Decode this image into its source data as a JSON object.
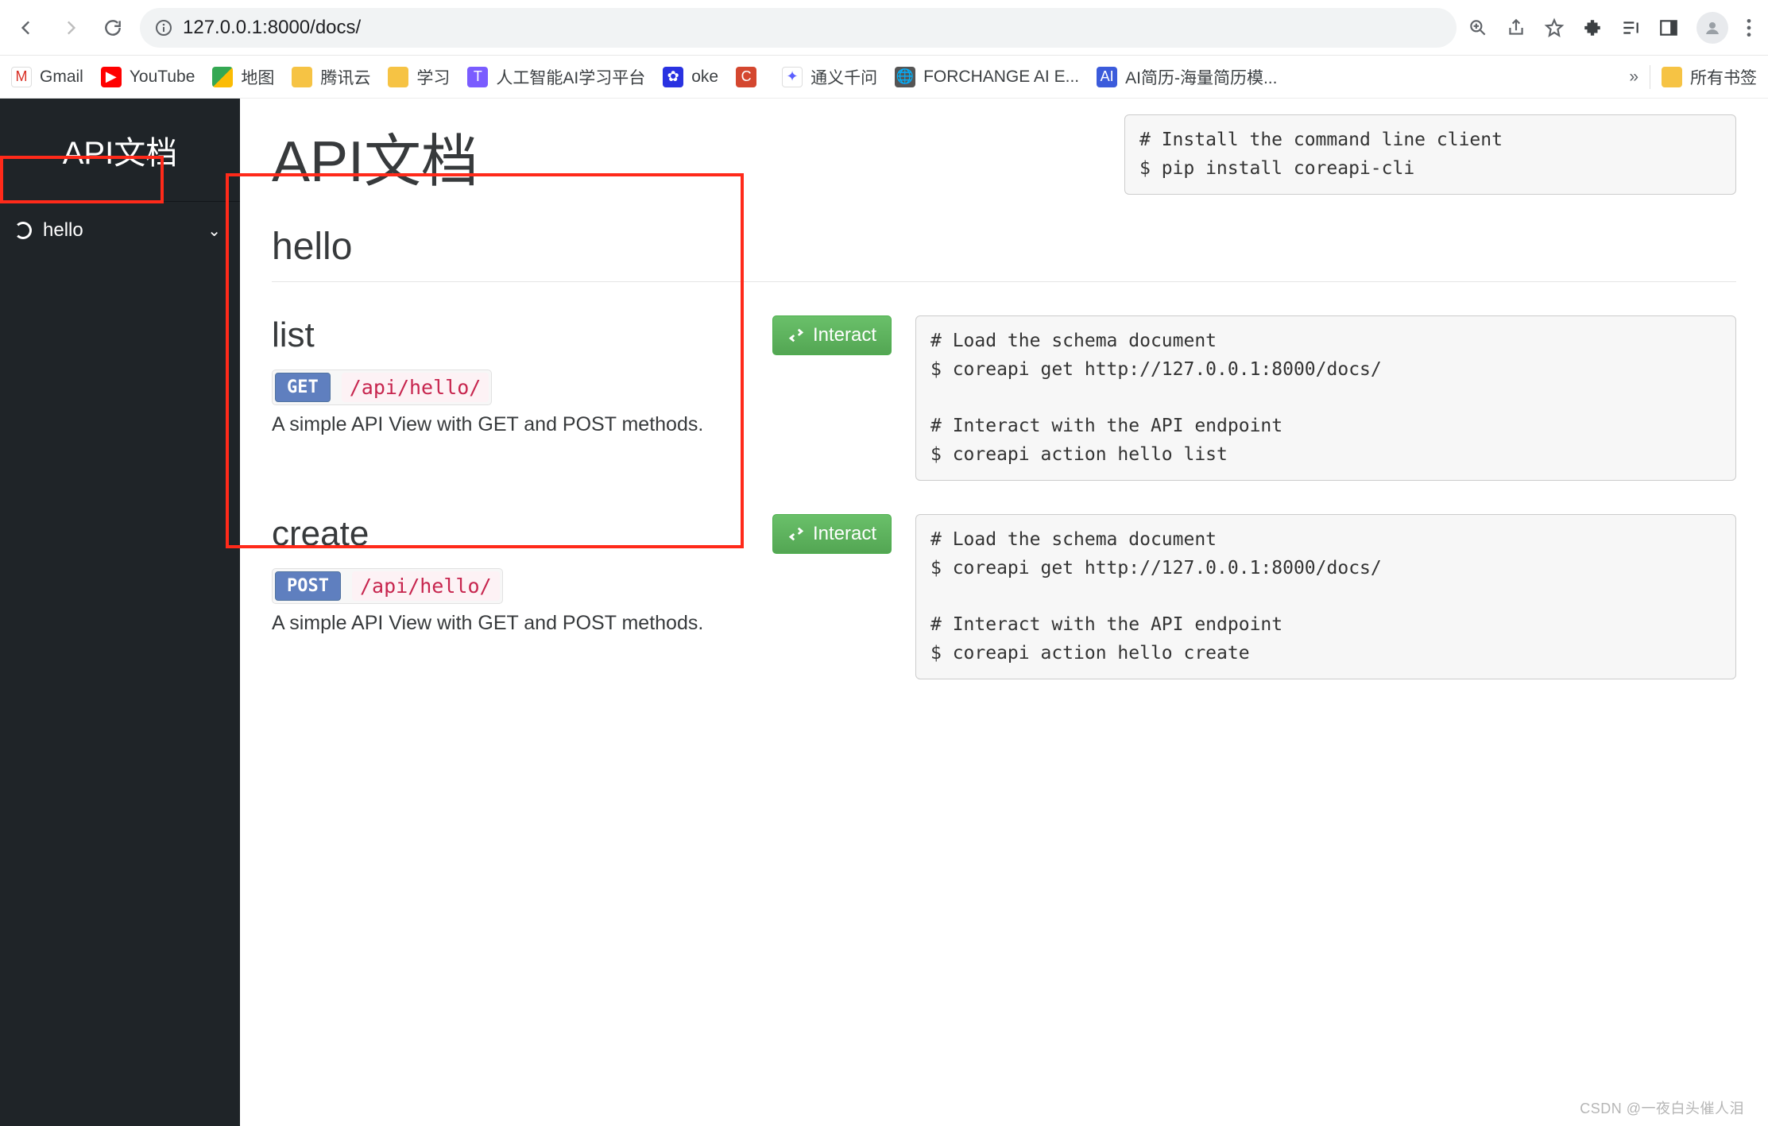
{
  "browser": {
    "url": "127.0.0.1:8000/docs/",
    "right_icons": [
      "zoom",
      "share",
      "star",
      "extensions",
      "reading-list",
      "side-panel",
      "profile",
      "menu"
    ]
  },
  "bookmarks": [
    {
      "label": "Gmail",
      "icon": "gmail"
    },
    {
      "label": "YouTube",
      "icon": "youtube"
    },
    {
      "label": "地图",
      "icon": "maps"
    },
    {
      "label": "腾讯云",
      "icon": "folder"
    },
    {
      "label": "学习",
      "icon": "folder"
    },
    {
      "label": "人工智能AI学习平台",
      "icon": "ai"
    },
    {
      "label": "oke",
      "icon": "baidu"
    },
    {
      "label": "",
      "icon": "c"
    },
    {
      "label": "通义千问",
      "icon": "qwen"
    },
    {
      "label": "FORCHANGE AI E...",
      "icon": "globe"
    },
    {
      "label": "AI简历-海量简历模...",
      "icon": "ai2"
    }
  ],
  "bookmarks_overflow": "»",
  "bookmarks_all": "所有书签",
  "sidebar": {
    "title": "API文档",
    "items": [
      {
        "label": "hello"
      }
    ]
  },
  "main": {
    "title": "API文档",
    "install_box": "# Install the command line client\n$ pip install coreapi-cli",
    "section_title": "hello",
    "interact_label": "Interact",
    "endpoints": [
      {
        "name": "list",
        "method": "GET",
        "path": "/api/hello/",
        "description": "A simple API View with GET and POST methods.",
        "code": "# Load the schema document\n$ coreapi get http://127.0.0.1:8000/docs/\n\n# Interact with the API endpoint\n$ coreapi action hello list"
      },
      {
        "name": "create",
        "method": "POST",
        "path": "/api/hello/",
        "description": "A simple API View with GET and POST methods.",
        "code": "# Load the schema document\n$ coreapi get http://127.0.0.1:8000/docs/\n\n# Interact with the API endpoint\n$ coreapi action hello create"
      }
    ]
  },
  "watermark": "CSDN @一夜白头催人泪"
}
